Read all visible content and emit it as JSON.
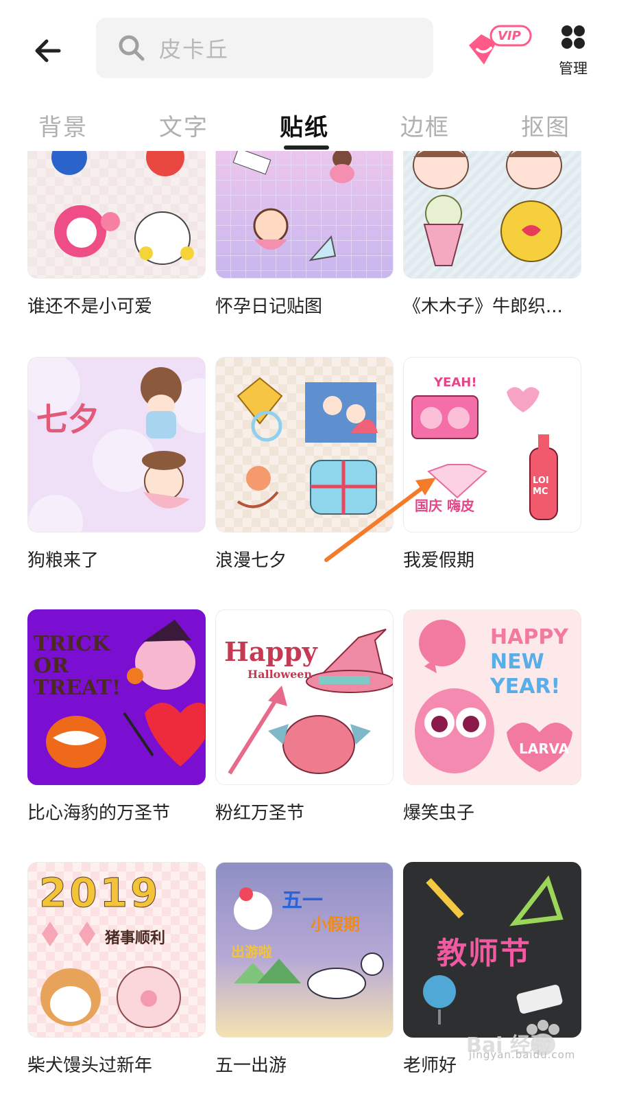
{
  "search": {
    "placeholder": "皮卡丘"
  },
  "header": {
    "vip_badge": "VIP",
    "manage_label": "管理"
  },
  "tabs": [
    {
      "label": "背景"
    },
    {
      "label": "文字"
    },
    {
      "label": "贴纸",
      "active": true
    },
    {
      "label": "边框"
    },
    {
      "label": "抠图"
    }
  ],
  "stickers": [
    {
      "title": "谁还不是小可爱"
    },
    {
      "title": "怀孕日记贴图"
    },
    {
      "title": "《木木子》牛郎织..."
    },
    {
      "title": "狗粮来了",
      "thumb_text": "七夕"
    },
    {
      "title": "浪漫七夕"
    },
    {
      "title": "我爱假期",
      "thumb_text": "YEAH!",
      "thumb_text2": "国庆 嗨皮",
      "thumb_text3": "LOI MC"
    },
    {
      "title": "比心海豹的万圣节",
      "thumb_text": "TRICK OR TREAT!"
    },
    {
      "title": "粉红万圣节",
      "thumb_text": "Happy",
      "thumb_text2": "Halloween"
    },
    {
      "title": "爆笑虫子",
      "thumb_text": "HAPPY",
      "thumb_text2": "NEW",
      "thumb_text3": "YEAR!",
      "thumb_text4": "LARVA"
    },
    {
      "title": "柴犬馒头过新年",
      "thumb_text": "2019",
      "thumb_text2": "猪事顺利"
    },
    {
      "title": "五一出游",
      "thumb_text": "五一",
      "thumb_text2": "小假期",
      "thumb_text3": "出游啦"
    },
    {
      "title": "老师好",
      "thumb_text": "教师节"
    }
  ],
  "watermark": {
    "text": "Bai 经验",
    "sub": "jingyan.baidu.com"
  },
  "colors": {
    "accent": "#ff5a8a",
    "arrow": "#f47b2a",
    "active_tab": "#111111",
    "inactive_tab": "#b0b0b0"
  }
}
